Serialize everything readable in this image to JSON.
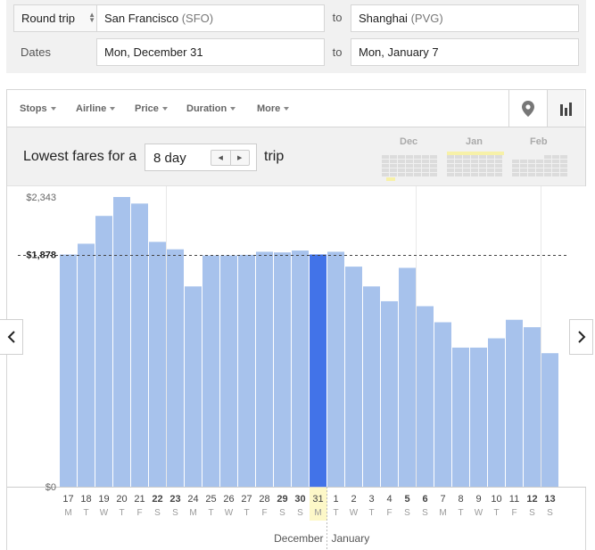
{
  "search": {
    "trip_type": "Round trip",
    "origin_city": "San Francisco",
    "origin_code": "(SFO)",
    "to_label": "to",
    "destination_city": "Shanghai",
    "destination_code": "(PVG)",
    "dates_label": "Dates",
    "depart_date": "Mon, December 31",
    "return_date": "Mon, January 7"
  },
  "filters": [
    "Stops",
    "Airline",
    "Price",
    "Duration",
    "More"
  ],
  "views": {
    "map_icon": "map-pin-icon",
    "chart_icon": "bar-chart-icon"
  },
  "fare_bar": {
    "prefix": "Lowest fares for a",
    "trip_length": "8 day",
    "suffix": "trip",
    "months": [
      "Dec",
      "Jan",
      "Feb"
    ]
  },
  "colors": {
    "bar": "#a7c2ec",
    "bar_selected": "#4273e8",
    "highlight": "#fdf8c8"
  },
  "chart_data": {
    "type": "bar",
    "y_tick_labels": [
      "$2,343",
      "$1,878",
      "$0"
    ],
    "y_ticks": [
      2343,
      1878,
      0
    ],
    "ylim": [
      0,
      2343
    ],
    "reference_line": 1878,
    "selected_index": 14,
    "days": [
      "17",
      "18",
      "19",
      "20",
      "21",
      "22",
      "23",
      "24",
      "25",
      "26",
      "27",
      "28",
      "29",
      "30",
      "31",
      "1",
      "2",
      "3",
      "4",
      "5",
      "6",
      "7",
      "8",
      "9",
      "10",
      "11",
      "12",
      "13"
    ],
    "weekdays": [
      "M",
      "T",
      "W",
      "T",
      "F",
      "S",
      "S",
      "M",
      "T",
      "W",
      "T",
      "F",
      "S",
      "S",
      "M",
      "T",
      "W",
      "T",
      "F",
      "S",
      "S",
      "M",
      "T",
      "W",
      "T",
      "F",
      "S",
      "S"
    ],
    "bold_days": [
      5,
      6,
      12,
      13,
      19,
      20,
      26,
      27
    ],
    "values": [
      1878,
      1965,
      2190,
      2343,
      2290,
      1980,
      1920,
      1620,
      1870,
      1870,
      1875,
      1900,
      1895,
      1910,
      1878,
      1900,
      1780,
      1620,
      1500,
      1770,
      1460,
      1330,
      1125,
      1125,
      1200,
      1350,
      1290,
      1080
    ],
    "month_labels": [
      "December",
      "January"
    ]
  }
}
